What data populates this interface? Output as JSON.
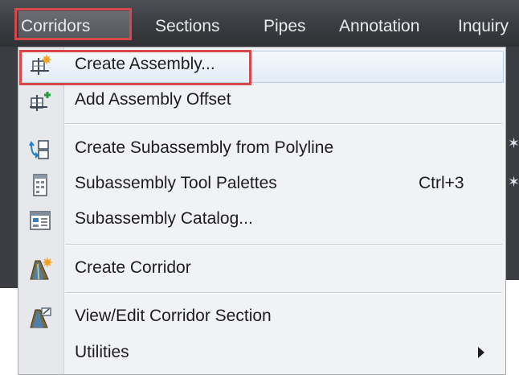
{
  "menubar": {
    "items": [
      "Corridors",
      "Sections",
      "Pipes",
      "Annotation",
      "Inquiry"
    ]
  },
  "dropdown": {
    "items": [
      {
        "label": "Create Assembly...",
        "icon": "create-assembly-icon"
      },
      {
        "label": "Add Assembly Offset",
        "icon": "add-assembly-offset-icon"
      },
      {
        "label": "Create Subassembly from Polyline",
        "icon": "create-subassembly-icon"
      },
      {
        "label": "Subassembly Tool Palettes",
        "shortcut": "Ctrl+3",
        "icon": "tool-palettes-icon"
      },
      {
        "label": "Subassembly Catalog...",
        "icon": "catalog-icon"
      },
      {
        "label": "Create Corridor",
        "icon": "create-corridor-icon"
      },
      {
        "label": "View/Edit Corridor Section",
        "icon": "view-edit-section-icon"
      },
      {
        "label": "Utilities",
        "icon": "",
        "has_submenu": true
      }
    ]
  },
  "colors": {
    "menubar_bg": "#3a3c41",
    "menu_bg": "#f1f2f4",
    "highlight_box": "#d8484a",
    "hover_border": "#b9cde6"
  }
}
